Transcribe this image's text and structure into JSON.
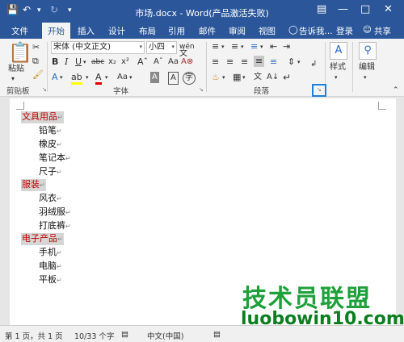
{
  "titlebar": {
    "title": "市场.docx - Word(产品激活失败)",
    "save_icon": "save-icon",
    "undo_icon": "undo-icon",
    "redo_icon": "redo-icon",
    "customize_icon": "customize-qat-icon"
  },
  "tabs": [
    "文件",
    "开始",
    "插入",
    "设计",
    "布局",
    "引用",
    "邮件",
    "审阅",
    "视图"
  ],
  "tellme": "告诉我...",
  "signin": "登录",
  "share": "共享",
  "clipboard": {
    "paste": "粘贴",
    "label": "剪贴板"
  },
  "font": {
    "name": "宋体 (中文正文)",
    "size": "小四",
    "label": "字体",
    "wen": "wén"
  },
  "paragraph": {
    "label": "段落"
  },
  "styles": {
    "label": "样式"
  },
  "editing": {
    "label": "编辑"
  },
  "document": {
    "lines": [
      {
        "text": "文具用品",
        "heading": true
      },
      {
        "text": "铅笔",
        "heading": false
      },
      {
        "text": "橡皮",
        "heading": false
      },
      {
        "text": "笔记本",
        "heading": false
      },
      {
        "text": "尺子",
        "heading": false
      },
      {
        "text": "服装",
        "heading": true
      },
      {
        "text": "风衣",
        "heading": false
      },
      {
        "text": "羽绒服",
        "heading": false
      },
      {
        "text": "打底裤",
        "heading": false
      },
      {
        "text": "电子产品",
        "heading": true
      },
      {
        "text": "手机",
        "heading": false
      },
      {
        "text": "电脑",
        "heading": false
      },
      {
        "text": "平板",
        "heading": false
      }
    ]
  },
  "watermark": {
    "cn": "技术员联盟",
    "url": "luobowin10.com"
  },
  "status": {
    "page": "第 1 页，共 1 页",
    "words": "10/33 个字",
    "lang": "中文(中国)"
  },
  "colors": {
    "accent": "#2b579a",
    "heading_text": "#c00000",
    "heading_bg": "#d6d6d6",
    "highlight_border": "#1e7fd6"
  }
}
